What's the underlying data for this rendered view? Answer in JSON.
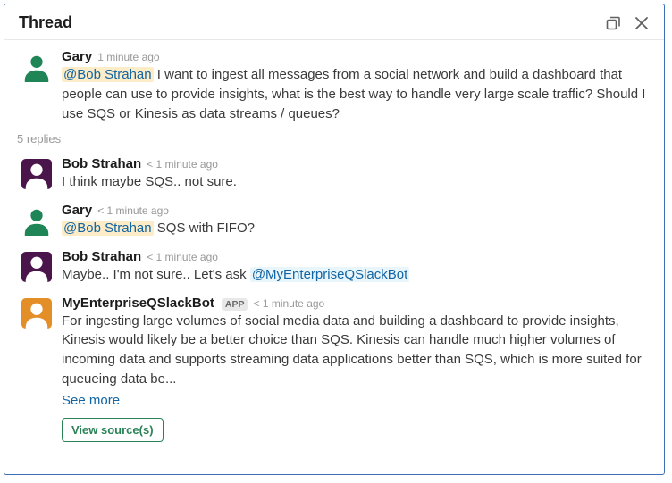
{
  "header": {
    "title": "Thread"
  },
  "replies_label": "5 replies",
  "see_more_label": "See more",
  "view_sources_label": "View source(s)",
  "app_badge": "APP",
  "colors": {
    "gary": "#1f8456",
    "bob": "#4a154b",
    "bot": "#e38e27"
  },
  "messages": [
    {
      "author": "Gary",
      "time": "1 minute ago",
      "time_prefix": "",
      "avatar": "gary",
      "mention": "@Bob Strahan",
      "mention_style": "yellow",
      "text_after": " I want to ingest all messages from a social network and build a dashboard that people can use to provide insights, what is the best way to handle very large scale traffic? Should I use SQS or Kinesis as data streams / queues?"
    },
    {
      "author": "Bob Strahan",
      "time": "1 minute ago",
      "time_prefix": "< ",
      "avatar": "bob",
      "text_plain": "I think maybe SQS.. not sure."
    },
    {
      "author": "Gary",
      "time": "1 minute ago",
      "time_prefix": "< ",
      "avatar": "gary",
      "mention": "@Bob Strahan",
      "mention_style": "yellow",
      "text_after": " SQS with FIFO?"
    },
    {
      "author": "Bob Strahan",
      "time": "1 minute ago",
      "time_prefix": "< ",
      "avatar": "bob",
      "text_before": "Maybe.. I'm not sure.. Let's ask ",
      "mention": "@MyEnterpriseQSlackBot",
      "mention_style": "blue"
    },
    {
      "author": "MyEnterpriseQSlackBot",
      "app": true,
      "time": "1 minute ago",
      "time_prefix": "< ",
      "avatar": "bot",
      "text_plain": "For ingesting large volumes of social media data and building a dashboard to provide insights, Kinesis would likely be a better choice than SQS. Kinesis can handle much higher volumes of incoming data and supports streaming data applications better than SQS, which is more suited for queueing data be...",
      "see_more": true,
      "view_sources": true
    }
  ]
}
